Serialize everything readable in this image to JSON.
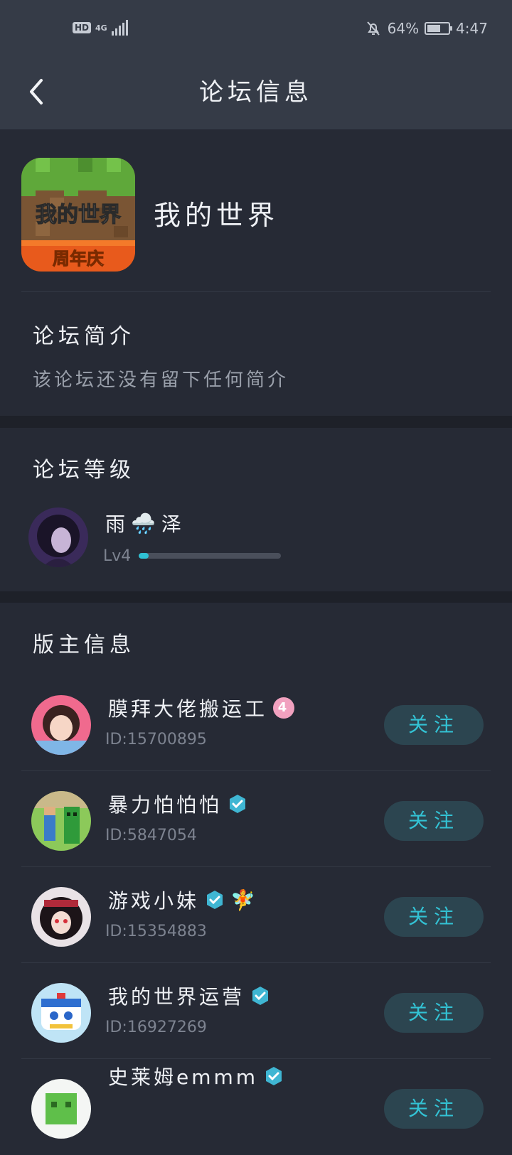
{
  "status_bar": {
    "network_hd": "HD",
    "network_gen": "4G",
    "battery_percent": "64%",
    "battery_level": 0.64,
    "time": "4:47",
    "icons": [
      "hd-icon",
      "signal-icon",
      "bell-muted-icon",
      "battery-icon"
    ]
  },
  "nav": {
    "title": "论坛信息",
    "back_icon": "chevron-left-icon"
  },
  "forum": {
    "name": "我的世界",
    "icon_text": "我的世界",
    "icon_subtext": "周年庆",
    "intro_title": "论坛简介",
    "intro_text": "该论坛还没有留下任何简介"
  },
  "level": {
    "title": "论坛等级",
    "user_name_left": "雨",
    "user_name_right": "泽",
    "user_name_emoji": "🌧️",
    "level_label": "Lv4",
    "progress": 0.07
  },
  "moderators": {
    "title": "版主信息",
    "follow_label": "关注",
    "colors": {
      "accent": "#33c2d4",
      "follow_bg": "#2c4550",
      "verified": "#3fb6d3"
    },
    "items": [
      {
        "name": "膜拜大佬搬运工",
        "id": "ID:15700895",
        "badge": "4"
      },
      {
        "name": "暴力怕怕怕",
        "id": "ID:5847054",
        "verified": true
      },
      {
        "name": "游戏小妹",
        "id": "ID:15354883",
        "verified": true,
        "extra_emoji": "🧚"
      },
      {
        "name": "我的世界运营",
        "id": "ID:16927269",
        "verified": true
      },
      {
        "name": "史莱姆emmm",
        "id": "",
        "verified": true
      }
    ]
  }
}
